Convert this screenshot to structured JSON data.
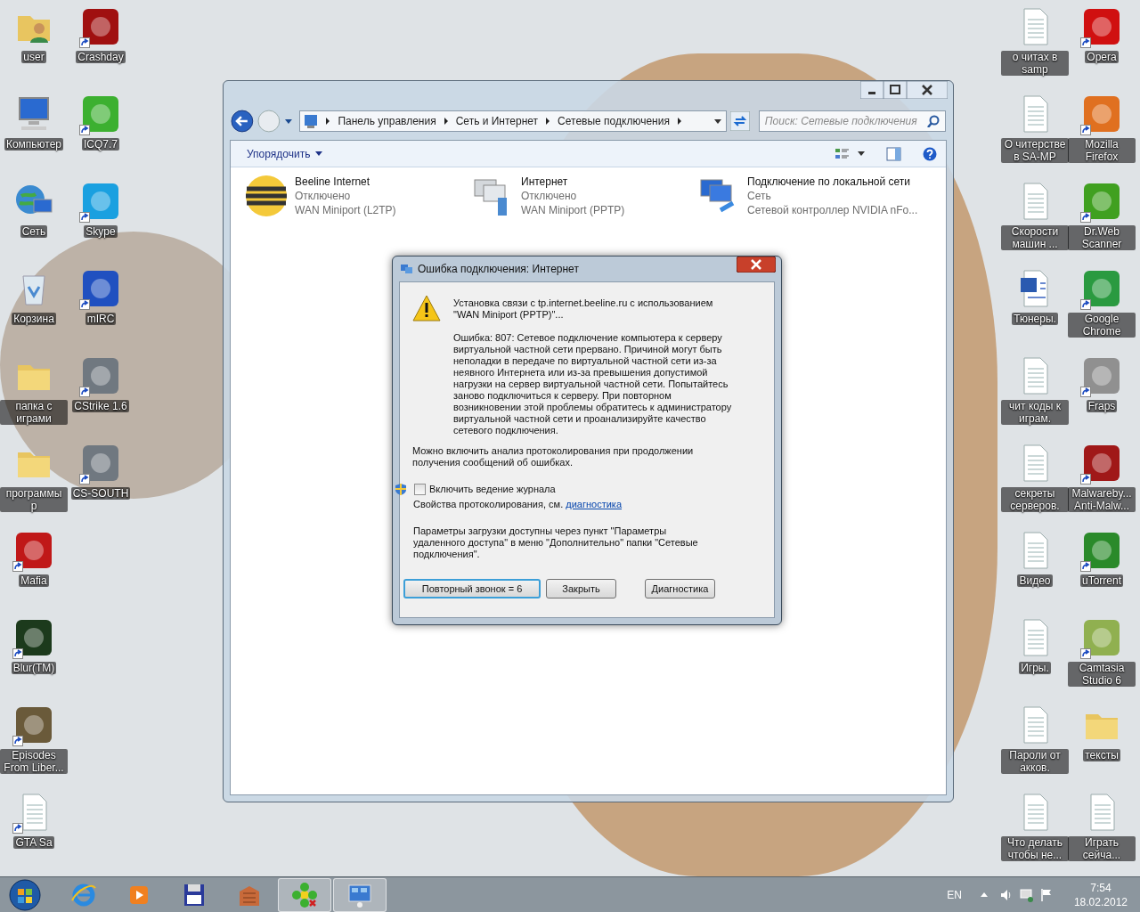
{
  "desktop": {
    "columns": [
      [
        {
          "label": "user",
          "kind": "userfolder",
          "shortcut": false
        },
        {
          "label": "Компьютер",
          "kind": "computer",
          "shortcut": false
        },
        {
          "label": "Сеть",
          "kind": "network",
          "shortcut": false
        },
        {
          "label": "Корзина",
          "kind": "recycle",
          "shortcut": false
        },
        {
          "label": "папка с играми",
          "kind": "folder",
          "shortcut": false
        },
        {
          "label": "программы р",
          "kind": "folder",
          "shortcut": false
        },
        {
          "label": "Mafia",
          "kind": "app",
          "color": "#c01818",
          "shortcut": true
        },
        {
          "label": "Blur(TM)",
          "kind": "app",
          "color": "#1c3a1c",
          "shortcut": true
        },
        {
          "label": "Episodes From Liber...",
          "kind": "app",
          "color": "#6a5a3a",
          "shortcut": true
        },
        {
          "label": "GTA Sa",
          "kind": "doc",
          "shortcut": true
        }
      ],
      [
        {
          "label": "Crashday",
          "kind": "app",
          "color": "#a01010",
          "shortcut": true
        },
        {
          "label": "ICQ7.7",
          "kind": "app",
          "color": "#3cb030",
          "shortcut": true
        },
        {
          "label": "Skype",
          "kind": "app",
          "color": "#1aa0e0",
          "shortcut": true
        },
        {
          "label": "mIRC",
          "kind": "app",
          "color": "#2050c0",
          "shortcut": true
        },
        {
          "label": "CStrike 1.6",
          "kind": "app",
          "color": "#707880",
          "shortcut": true
        },
        {
          "label": "CS-SOUTH",
          "kind": "app",
          "color": "#707880",
          "shortcut": true
        }
      ],
      [
        {
          "label": "о читах в samp",
          "kind": "doc",
          "shortcut": false
        },
        {
          "label": "О читерстве в SA-MP",
          "kind": "doc",
          "shortcut": false
        },
        {
          "label": "Скорости машин ...",
          "kind": "doc",
          "shortcut": false
        },
        {
          "label": "Тюнеры.",
          "kind": "word",
          "shortcut": false
        },
        {
          "label": "чит коды к играм.",
          "kind": "doc",
          "shortcut": false
        },
        {
          "label": "секреты серверов.",
          "kind": "doc",
          "shortcut": false
        },
        {
          "label": "Видео",
          "kind": "doc",
          "shortcut": false
        },
        {
          "label": "Игры.",
          "kind": "doc",
          "shortcut": false
        },
        {
          "label": "Пароли от акков.",
          "kind": "doc",
          "shortcut": false
        },
        {
          "label": "Что делать чтобы не...",
          "kind": "doc",
          "shortcut": false
        }
      ],
      [
        {
          "label": "Opera",
          "kind": "app",
          "color": "#d01010",
          "shortcut": true
        },
        {
          "label": "Mozilla Firefox",
          "kind": "app",
          "color": "#e07020",
          "shortcut": true
        },
        {
          "label": "Dr.Web Scanner",
          "kind": "app",
          "color": "#40a020",
          "shortcut": true
        },
        {
          "label": "Google Chrome",
          "kind": "app",
          "color": "#2a9a40",
          "shortcut": true
        },
        {
          "label": "Fraps",
          "kind": "app",
          "color": "#909090",
          "shortcut": true
        },
        {
          "label": "Malwareby... Anti-Malw...",
          "kind": "app",
          "color": "#a01818",
          "shortcut": true
        },
        {
          "label": "uTorrent",
          "kind": "app",
          "color": "#2a8a2a",
          "shortcut": true
        },
        {
          "label": "Camtasia Studio 6",
          "kind": "app",
          "color": "#90b050",
          "shortcut": true
        },
        {
          "label": "тексты",
          "kind": "folder",
          "shortcut": false
        },
        {
          "label": "Играть сейча...",
          "kind": "doc",
          "shortcut": false
        }
      ]
    ]
  },
  "explorer": {
    "breadcrumb": [
      "Панель управления",
      "Сеть и Интернет",
      "Сетевые подключения"
    ],
    "search": {
      "placeholder": "Поиск: Сетевые подключения"
    },
    "toolbar": {
      "organize": "Упорядочить"
    },
    "connections": [
      {
        "kind": "beeline",
        "name": "Beeline Internet",
        "status": "Отключено",
        "device": "WAN Miniport (L2TP)"
      },
      {
        "kind": "vpn",
        "name": "Интернет",
        "status": "Отключено",
        "device": "WAN Miniport (PPTP)"
      },
      {
        "kind": "lan",
        "name": "Подключение по локальной сети",
        "status": "Сеть",
        "device": "Сетевой контроллер NVIDIA nFo..."
      }
    ]
  },
  "dialog": {
    "title": "Ошибка подключения: Интернет",
    "connecting": "Установка связи с tp.internet.beeline.ru с использованием \"WAN Miniport (PPTP)\"...",
    "error": "Ошибка: 807: Сетевое подключение компьютера к серверу виртуальной частной сети прервано.  Причиной могут быть неполадки в передаче по виртуальной частной сети из-за неявного Интернета или из-за превышения допустимой нагрузки на сервер виртуальной частной сети.  Попытайтесь заново подключиться к серверу.  При повторном возникновении этой проблемы обратитесь к администратору виртуальной частной сети и проанализируйте качество сетевого подключения.",
    "logging_note": "Можно включить анализ протоколирования при продолжении получения сообщений об ошибках.",
    "logging": {
      "label": "Включить ведение журнала",
      "checked": false
    },
    "properties": "Свойства протоколирования, см.",
    "link": "диагностика",
    "params_note": "Параметры загрузки доступны через пункт \"Параметры удаленного доступа\" в меню \"Дополнительно\" папки \"Сетевые подключения\".",
    "buttons": [
      {
        "label": "Повторный звонок = 6",
        "default": true
      },
      {
        "label": "Закрыть",
        "default": false
      },
      {
        "label": "Диагностика",
        "default": false
      }
    ]
  },
  "taskbar": {
    "items": [
      {
        "kind": "ie",
        "running": false
      },
      {
        "kind": "media",
        "running": false
      },
      {
        "kind": "floppy",
        "running": false
      },
      {
        "kind": "game",
        "running": false
      },
      {
        "kind": "icq",
        "running": true
      },
      {
        "kind": "network",
        "running": true
      }
    ],
    "language": "EN",
    "time": "7:54",
    "date": "18.02.2012"
  }
}
